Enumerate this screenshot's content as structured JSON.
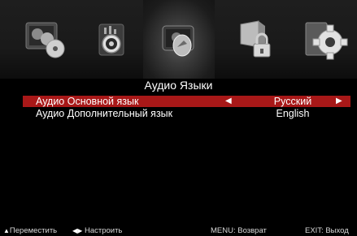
{
  "menu": {
    "title": "Аудио Языки",
    "items": [
      {
        "label": "Аудио Основной язык",
        "value": "Русский",
        "selected": true
      },
      {
        "label": "Аудио Дополнительный язык",
        "value": "English",
        "selected": false
      }
    ]
  },
  "icons": [
    "picture-icon",
    "sound-icon",
    "channel-icon",
    "lock-icon",
    "settings-icon"
  ],
  "hints": {
    "move": "Переместить",
    "adjust": "Настроить",
    "menu": "MENU: Возврат",
    "exit": "EXIT: Выход"
  },
  "colors": {
    "selection": "#a81818",
    "background": "#000000"
  }
}
